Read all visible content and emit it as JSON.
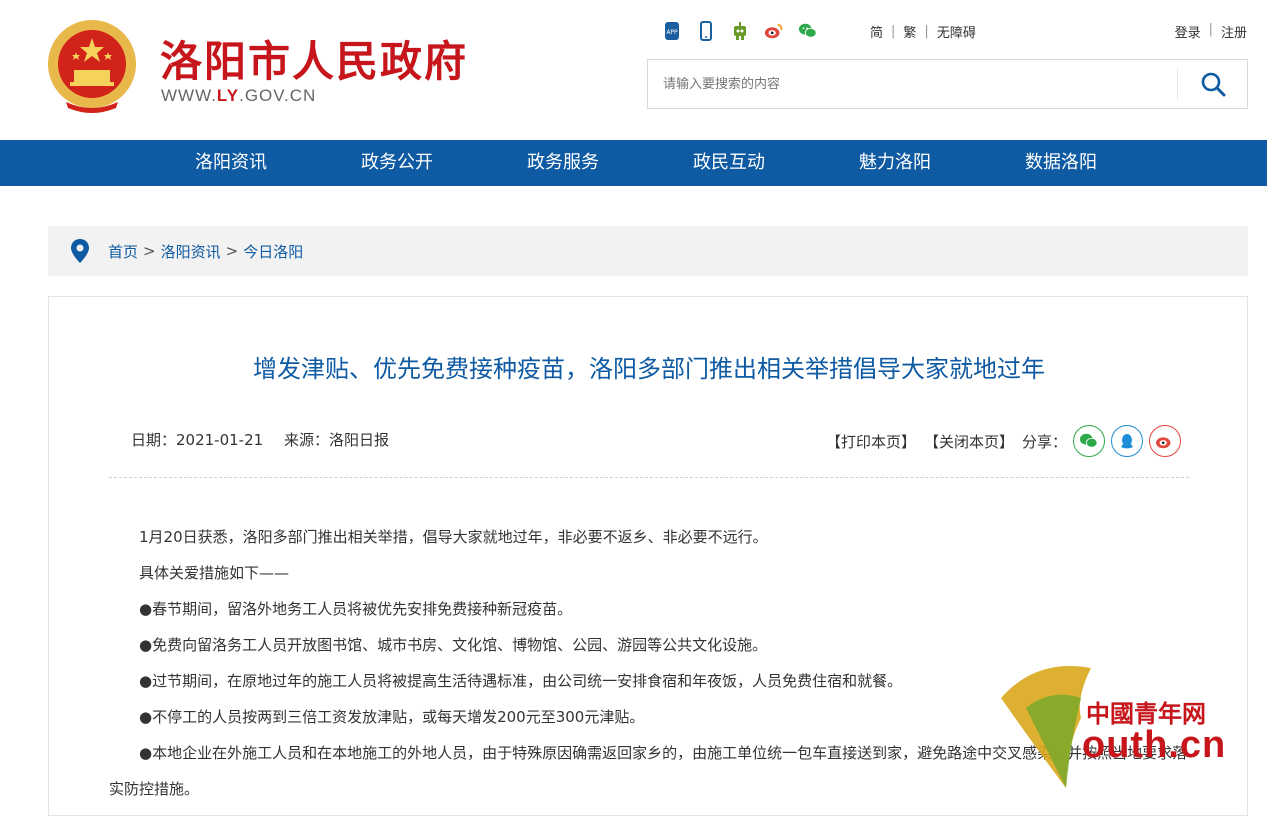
{
  "header": {
    "site_name": "洛阳市人民政府",
    "site_url_prefix": "WWW.",
    "site_url_highlight": "LY",
    "site_url_suffix": ".GOV.CN",
    "icons": [
      "app-icon",
      "mobile-icon",
      "robot-icon",
      "weibo-icon",
      "wechat-icon"
    ],
    "lang": {
      "simplified": "简",
      "traditional": "繁",
      "accessible": "无障碍"
    },
    "auth": {
      "login": "登录",
      "register": "注册"
    },
    "search": {
      "placeholder": "请输入要搜索的内容"
    }
  },
  "nav": {
    "items": [
      {
        "label": "洛阳资讯"
      },
      {
        "label": "政务公开"
      },
      {
        "label": "政务服务"
      },
      {
        "label": "政民互动"
      },
      {
        "label": "魅力洛阳"
      },
      {
        "label": "数据洛阳"
      }
    ]
  },
  "breadcrumb": {
    "items": [
      {
        "label": "首页"
      },
      {
        "label": "洛阳资讯"
      },
      {
        "label": "今日洛阳"
      }
    ],
    "separator": ">"
  },
  "article": {
    "title": "增发津贴、优先免费接种疫苗，洛阳多部门推出相关举措倡导大家就地过年",
    "date": "日期：2021-01-21",
    "source": "来源：洛阳日报",
    "print": "【打印本页】",
    "close": "【关闭本页】",
    "share_label": "分享：",
    "paragraphs": [
      "1月20日获悉，洛阳多部门推出相关举措，倡导大家就地过年，非必要不返乡、非必要不远行。",
      "具体关爱措施如下——",
      "●春节期间，留洛外地务工人员将被优先安排免费接种新冠疫苗。",
      "●免费向留洛务工人员开放图书馆、城市书房、文化馆、博物馆、公园、游园等公共文化设施。",
      "●过节期间，在原地过年的施工人员将被提高生活待遇标准，由公司统一安排食宿和年夜饭，人员免费住宿和就餐。",
      "●不停工的人员按两到三倍工资发放津贴，或每天增发200元至300元津贴。",
      "●本地企业在外施工人员和在本地施工的外地人员，由于特殊原因确需返回家乡的，由施工单位统一包车直接送到家，避免路途中交叉感染，并按照当地要求落实防控措施。"
    ]
  },
  "watermark": {
    "cn": "中國青年网",
    "en": "outh.cn"
  },
  "colors": {
    "brand_red": "#c6161c",
    "nav_blue": "#0e5aa3",
    "wechat_green": "#2ea94a",
    "qq_blue": "#1e8fd6",
    "weibo_red": "#e0463b"
  }
}
